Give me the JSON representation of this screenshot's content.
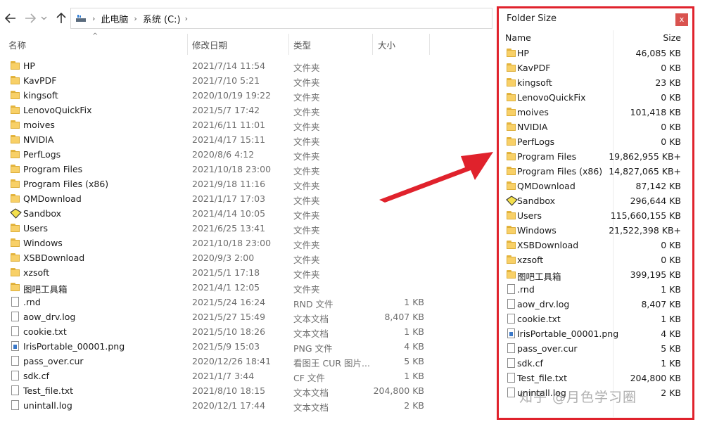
{
  "address": {
    "segments": [
      "此电脑",
      "系统 (C:)"
    ]
  },
  "explorer": {
    "columns": {
      "name": "名称",
      "date": "修改日期",
      "type": "类型",
      "size": "大小"
    },
    "rows": [
      {
        "name": "HP",
        "date": "2021/7/14 11:54",
        "type": "文件夹",
        "size": "",
        "icon": "folder"
      },
      {
        "name": "KavPDF",
        "date": "2021/7/10 5:21",
        "type": "文件夹",
        "size": "",
        "icon": "folder"
      },
      {
        "name": "kingsoft",
        "date": "2020/10/19 19:22",
        "type": "文件夹",
        "size": "",
        "icon": "folder"
      },
      {
        "name": "LenovoQuickFix",
        "date": "2021/5/7 17:42",
        "type": "文件夹",
        "size": "",
        "icon": "folder"
      },
      {
        "name": "moives",
        "date": "2021/6/11 11:01",
        "type": "文件夹",
        "size": "",
        "icon": "folder"
      },
      {
        "name": "NVIDIA",
        "date": "2021/4/17 15:11",
        "type": "文件夹",
        "size": "",
        "icon": "folder"
      },
      {
        "name": "PerfLogs",
        "date": "2020/8/6 4:12",
        "type": "文件夹",
        "size": "",
        "icon": "folder"
      },
      {
        "name": "Program Files",
        "date": "2021/10/18 23:00",
        "type": "文件夹",
        "size": "",
        "icon": "folder"
      },
      {
        "name": "Program Files (x86)",
        "date": "2021/9/18 11:16",
        "type": "文件夹",
        "size": "",
        "icon": "folder"
      },
      {
        "name": "QMDownload",
        "date": "2021/1/17 17:03",
        "type": "文件夹",
        "size": "",
        "icon": "folder"
      },
      {
        "name": "Sandbox",
        "date": "2021/4/14 10:05",
        "type": "文件夹",
        "size": "",
        "icon": "sandbox"
      },
      {
        "name": "Users",
        "date": "2021/6/25 13:41",
        "type": "文件夹",
        "size": "",
        "icon": "folder"
      },
      {
        "name": "Windows",
        "date": "2021/10/18 23:00",
        "type": "文件夹",
        "size": "",
        "icon": "folder"
      },
      {
        "name": "XSBDownload",
        "date": "2020/9/3 2:00",
        "type": "文件夹",
        "size": "",
        "icon": "folder"
      },
      {
        "name": "xzsoft",
        "date": "2021/5/1 17:18",
        "type": "文件夹",
        "size": "",
        "icon": "folder"
      },
      {
        "name": "图吧工具箱",
        "date": "2021/4/1 12:05",
        "type": "文件夹",
        "size": "",
        "icon": "folder"
      },
      {
        "name": ".rnd",
        "date": "2021/5/24 16:24",
        "type": "RND 文件",
        "size": "1 KB",
        "icon": "file"
      },
      {
        "name": "aow_drv.log",
        "date": "2021/5/27 15:49",
        "type": "文本文档",
        "size": "8,407 KB",
        "icon": "file"
      },
      {
        "name": "cookie.txt",
        "date": "2021/5/10 18:26",
        "type": "文本文档",
        "size": "1 KB",
        "icon": "file"
      },
      {
        "name": "IrisPortable_00001.png",
        "date": "2021/5/9 15:03",
        "type": "PNG 文件",
        "size": "4 KB",
        "icon": "png"
      },
      {
        "name": "pass_over.cur",
        "date": "2020/12/26 18:41",
        "type": "看图王 CUR 图片...",
        "size": "5 KB",
        "icon": "file"
      },
      {
        "name": "sdk.cf",
        "date": "2021/1/7 3:44",
        "type": "CF 文件",
        "size": "1 KB",
        "icon": "file"
      },
      {
        "name": "Test_file.txt",
        "date": "2021/8/10 18:15",
        "type": "文本文档",
        "size": "204,800 KB",
        "icon": "file"
      },
      {
        "name": "unintall.log",
        "date": "2020/12/1 17:44",
        "type": "文本文档",
        "size": "2 KB",
        "icon": "file"
      }
    ]
  },
  "folder_size": {
    "title": "Folder Size",
    "close_label": "x",
    "col_name": "Name",
    "col_size": "Size",
    "rows": [
      {
        "name": "HP",
        "size": "46,085 KB",
        "icon": "folder"
      },
      {
        "name": "KavPDF",
        "size": "0 KB",
        "icon": "folder"
      },
      {
        "name": "kingsoft",
        "size": "23 KB",
        "icon": "folder"
      },
      {
        "name": "LenovoQuickFix",
        "size": "0 KB",
        "icon": "folder"
      },
      {
        "name": "moives",
        "size": "101,418 KB",
        "icon": "folder"
      },
      {
        "name": "NVIDIA",
        "size": "0 KB",
        "icon": "folder"
      },
      {
        "name": "PerfLogs",
        "size": "0 KB",
        "icon": "folder"
      },
      {
        "name": "Program Files",
        "size": "19,862,955 KB+",
        "icon": "folder"
      },
      {
        "name": "Program Files (x86)",
        "size": "14,827,065 KB+",
        "icon": "folder"
      },
      {
        "name": "QMDownload",
        "size": "87,142 KB",
        "icon": "folder"
      },
      {
        "name": "Sandbox",
        "size": "296,644 KB",
        "icon": "sandbox"
      },
      {
        "name": "Users",
        "size": "115,660,155 KB",
        "icon": "folder"
      },
      {
        "name": "Windows",
        "size": "21,522,398 KB+",
        "icon": "folder"
      },
      {
        "name": "XSBDownload",
        "size": "0 KB",
        "icon": "folder"
      },
      {
        "name": "xzsoft",
        "size": "0 KB",
        "icon": "folder"
      },
      {
        "name": "图吧工具箱",
        "size": "399,195 KB",
        "icon": "folder"
      },
      {
        "name": ".rnd",
        "size": "1 KB",
        "icon": "file"
      },
      {
        "name": "aow_drv.log",
        "size": "8,407 KB",
        "icon": "file"
      },
      {
        "name": "cookie.txt",
        "size": "1 KB",
        "icon": "file"
      },
      {
        "name": "IrisPortable_00001.png",
        "size": "4 KB",
        "icon": "png"
      },
      {
        "name": "pass_over.cur",
        "size": "5 KB",
        "icon": "file"
      },
      {
        "name": "sdk.cf",
        "size": "1 KB",
        "icon": "file"
      },
      {
        "name": "Test_file.txt",
        "size": "204,800 KB",
        "icon": "file"
      },
      {
        "name": "unintall.log",
        "size": "2 KB",
        "icon": "file"
      }
    ]
  },
  "watermark": "知乎 @月色学习圈",
  "colors": {
    "highlight_border": "#e0222c",
    "folder": "#f8d067"
  }
}
